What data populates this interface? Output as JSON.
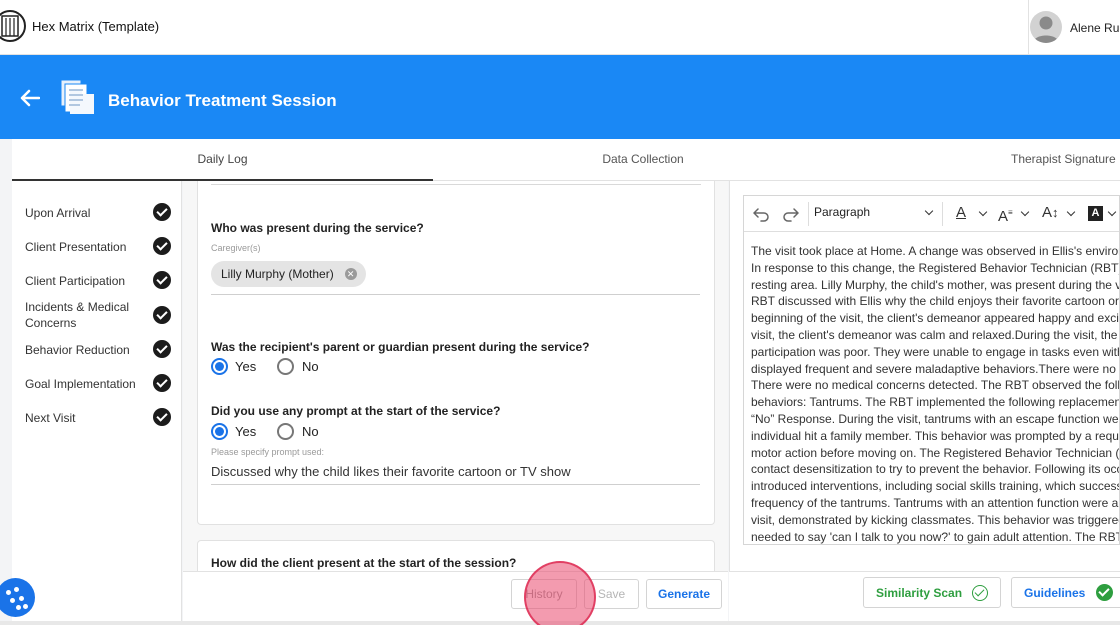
{
  "app": {
    "title": "Hex Matrix (Template)",
    "user_name": "Alene Ru"
  },
  "header": {
    "title": "Behavior Treatment Session"
  },
  "tabs": [
    {
      "label": "Daily Log",
      "active": true
    },
    {
      "label": "Data Collection",
      "active": false
    },
    {
      "label": "Therapist Signature",
      "active": false
    }
  ],
  "sidebar": {
    "items": [
      {
        "label": "Upon Arrival",
        "done": true
      },
      {
        "label": "Client Presentation",
        "done": true
      },
      {
        "label": "Client Participation",
        "done": true
      },
      {
        "label": "Incidents & Medical Concerns",
        "done": true
      },
      {
        "label": "Behavior Reduction",
        "done": true
      },
      {
        "label": "Goal Implementation",
        "done": true
      },
      {
        "label": "Next Visit",
        "done": true
      }
    ]
  },
  "form": {
    "q_present": "Who was present during the service?",
    "caregiver_label": "Caregiver(s)",
    "caregiver_chip": "Lilly Murphy (Mother)",
    "q_guardian": "Was the recipient's parent or guardian present during the service?",
    "q_prompt": "Did you use any prompt at the start of the service?",
    "yes_label": "Yes",
    "no_label": "No",
    "prompt_label": "Please specify prompt used:",
    "prompt_value": "Discussed why the child likes their favorite cartoon or TV show",
    "q_client_present": "How did the client present at the start of the session?"
  },
  "actions": {
    "history": "History",
    "save": "Save",
    "generate": "Generate"
  },
  "editor": {
    "block_format": "Paragraph",
    "lines": [
      "The visit took place at Home. A change was observed in Ellis's environm",
      "In response to this change, the Registered Behavior Technician (RBT) p",
      "resting area. Lilly Murphy, the child's mother, was present during the vis",
      "RBT discussed with Ellis why the child enjoys their favorite cartoon or T",
      "beginning of the visit, the client's demeanor appeared happy and excite",
      "visit, the client's demeanor was calm and relaxed.During the visit, the cl",
      "participation was poor. They were unable to engage in tasks even with",
      "displayed frequent and severe maladaptive behaviors.There were no inc",
      "There were no medical concerns detected. The RBT observed the follo",
      "behaviors: Tantrums. The RBT implemented the following replacement",
      "“No” Response. During the visit, tantrums with an escape function were",
      "individual hit a family member. This behavior was prompted by a reque",
      "motor action before moving on. The Registered Behavior Technician (R",
      "contact desensitization to try to prevent the behavior. Following its occ",
      "introduced interventions, including social skills training, which success",
      "frequency of the tantrums. Tantrums with an attention function were al",
      "visit, demonstrated by kicking classmates. This behavior was triggered",
      "needed to say 'can I talk to you now?' to gain adult attention. The RBT e"
    ]
  },
  "scan": {
    "similarity": "Similarity Scan",
    "guidelines": "Guidelines"
  },
  "colors": {
    "brand_blue": "#1a88f5",
    "link_blue": "#1a73e8",
    "success_green": "#2e9e3f"
  }
}
